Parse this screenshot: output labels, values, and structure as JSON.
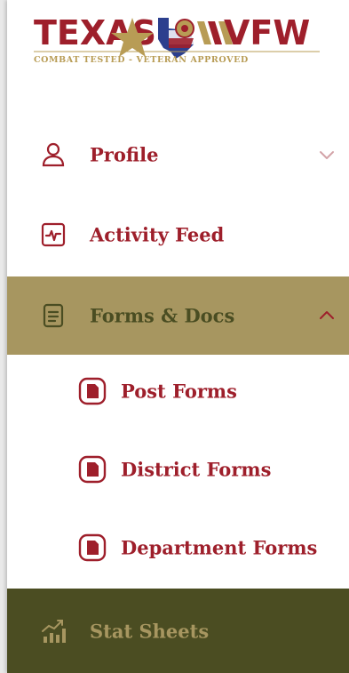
{
  "logo": {
    "left_text": "TEXAS",
    "right_text": "VFW",
    "tagline": "COMBAT TESTED - VETERAN APPROVED"
  },
  "menu": {
    "profile": {
      "label": "Profile",
      "icon": "user-icon",
      "chevron": "chevron-down-icon"
    },
    "activity": {
      "label": "Activity Feed",
      "icon": "activity-pulse-icon"
    },
    "forms": {
      "label": "Forms & Docs",
      "icon": "document-icon",
      "chevron": "chevron-up-icon",
      "expanded": true,
      "children": [
        {
          "label": "Post Forms",
          "icon": "form-badge-icon"
        },
        {
          "label": "District Forms",
          "icon": "form-badge-icon"
        },
        {
          "label": "Department Forms",
          "icon": "form-badge-icon"
        }
      ]
    },
    "stats": {
      "label": "Stat Sheets",
      "icon": "bar-chart-trend-icon"
    }
  },
  "colors": {
    "brand_red": "#9e1f2b",
    "active_bg": "#a79660",
    "active_text": "#4a4d22",
    "stat_bg": "#4b4d22",
    "stat_text": "#a79660",
    "chevron_muted": "#d3a3a8"
  }
}
